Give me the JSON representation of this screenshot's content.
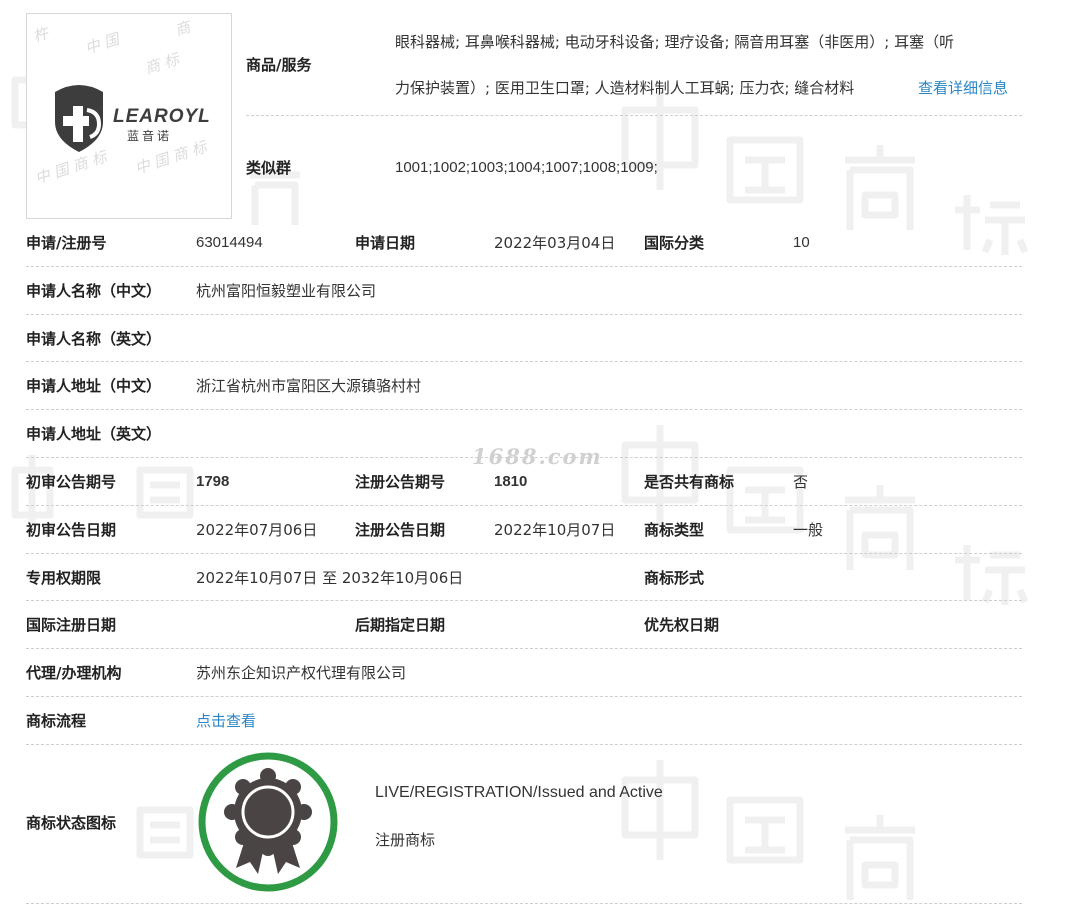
{
  "logo": {
    "brand": "LEAROYL",
    "brand_cn": "蓝音诺",
    "watermark_text": "中国商标"
  },
  "watermark": "1688.com",
  "goods": {
    "label": "商品/服务",
    "line1": "眼科器械; 耳鼻喉科器械; 电动牙科设备; 理疗设备; 隔音用耳塞（非医用）; 耳塞（听",
    "line2": "力保护装置）; 医用卫生口罩; 人造材料制人工耳蜗; 压力衣; 缝合材料",
    "detail_link": "查看详细信息"
  },
  "similar": {
    "label": "类似群",
    "value": "1001;1002;1003;1004;1007;1008;1009;"
  },
  "reg_no": {
    "label": "申请/注册号",
    "value": "63014494"
  },
  "app_date": {
    "label": "申请日期",
    "value": "2022年03月04日"
  },
  "intl_class": {
    "label": "国际分类",
    "value": "10"
  },
  "applicant_cn": {
    "label": "申请人名称（中文）",
    "value": "杭州富阳恒毅塑业有限公司"
  },
  "applicant_en": {
    "label": "申请人名称（英文）",
    "value": ""
  },
  "address_cn": {
    "label": "申请人地址（中文）",
    "value": "浙江省杭州市富阳区大源镇骆村村"
  },
  "address_en": {
    "label": "申请人地址（英文）",
    "value": ""
  },
  "prelim_issue": {
    "label": "初审公告期号",
    "value": "1798"
  },
  "reg_issue": {
    "label": "注册公告期号",
    "value": "1810"
  },
  "shared": {
    "label": "是否共有商标",
    "value": "否"
  },
  "prelim_date": {
    "label": "初审公告日期",
    "value": "2022年07月06日"
  },
  "reg_date": {
    "label": "注册公告日期",
    "value": "2022年10月07日"
  },
  "tm_type": {
    "label": "商标类型",
    "value": "一般"
  },
  "exclusive": {
    "label": "专用权期限",
    "value": "2022年10月07日 至 2032年10月06日"
  },
  "tm_form": {
    "label": "商标形式",
    "value": ""
  },
  "intl_reg_date": {
    "label": "国际注册日期",
    "value": ""
  },
  "later_date": {
    "label": "后期指定日期",
    "value": ""
  },
  "priority_date": {
    "label": "优先权日期",
    "value": ""
  },
  "agent": {
    "label": "代理/办理机构",
    "value": "苏州东企知识产权代理有限公司"
  },
  "process": {
    "label": "商标流程",
    "link": "点击查看"
  },
  "status": {
    "label": "商标状态图标",
    "line1": "LIVE/REGISTRATION/Issued and Active",
    "line2": "注册商标"
  },
  "colors": {
    "link": "#2a86c4",
    "status_ring": "#2e9a44",
    "medal": "#4a4544"
  }
}
